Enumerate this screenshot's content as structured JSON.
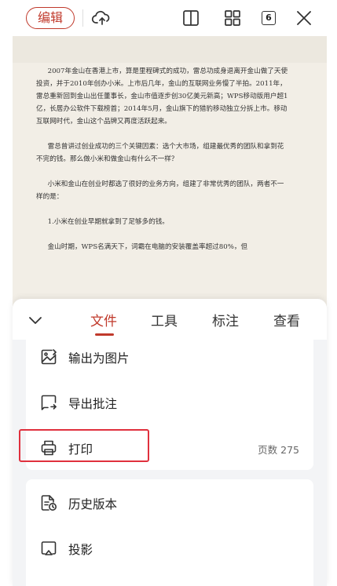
{
  "toolbar": {
    "edit_label": "编辑",
    "tab_count": "6",
    "icons": [
      "cloud-upload-icon",
      "split-view-icon",
      "grid-apps-icon",
      "tab-count-icon",
      "close-icon"
    ]
  },
  "document": {
    "paragraphs": [
      "2007年金山在香港上市，算是里程碑式的成功，雷总功成身退离开金山做了天使投资，并于2010年创办小米。上市后几年，金山的互联网业务慢了半拍。2011年，雷总重新回到金山出任董事长，金山市值逐步创30亿美元新高；WPS移动版用户超1亿，长居办公软件下载榜首；2014年5月，金山旗下的猎豹移动独立分拆上市。移动互联网时代，金山这个品牌又再度活跃起来。",
      "雷总曾讲过创业成功的三个关键因素：选个大市场，组建最优秀的团队和拿到花不完的钱。那么做小米和做金山有什么不一样？",
      "小米和金山在创业时都选了很好的业务方向，组建了非常优秀的团队，两者不一样的是：",
      "1.小米在创业早期就拿到了足够多的钱。",
      "金山时期，WPS名满天下，词霸在电脑的安装覆盖率超过80%，但"
    ]
  },
  "sheet": {
    "tabs": [
      "文件",
      "工具",
      "标注",
      "查看"
    ],
    "active_tab": "文件",
    "group1": [
      {
        "label": "输出为图片",
        "icon": "image-export-icon"
      },
      {
        "label": "导出批注",
        "icon": "comment-export-icon"
      },
      {
        "label": "打印",
        "icon": "printer-icon",
        "meta": "页数 275"
      }
    ],
    "group2": [
      {
        "label": "历史版本",
        "icon": "history-version-icon"
      },
      {
        "label": "投影",
        "icon": "projection-icon"
      }
    ]
  },
  "colors": {
    "accent": "#c0392b",
    "highlight_box": "#e0303d",
    "page_background": "#f2eee6"
  }
}
